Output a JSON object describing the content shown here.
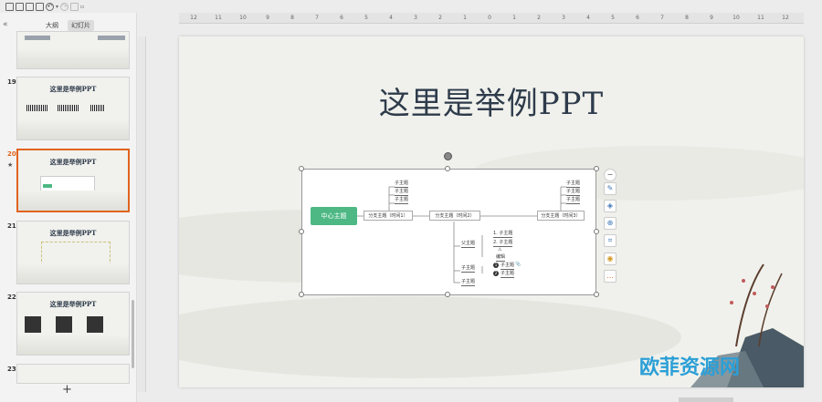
{
  "toolbar": {
    "icons": [
      "save-icon",
      "print-icon",
      "export-icon",
      "print-preview-icon",
      "undo-icon",
      "undo-dropdown-icon",
      "redo-icon",
      "format-painter-icon",
      "more-icon"
    ]
  },
  "sidebar": {
    "collapse_symbol": "«",
    "tabs": [
      {
        "label": "大纲",
        "active": false
      },
      {
        "label": "幻灯片",
        "active": true
      }
    ],
    "slides": [
      {
        "number": "",
        "title": ""
      },
      {
        "number": "19",
        "title": "这里是举例PPT"
      },
      {
        "number": "20",
        "title": "这里是举例PPT",
        "active": true,
        "star": "★"
      },
      {
        "number": "21",
        "title": "这里是举例PPT"
      },
      {
        "number": "22",
        "title": "这里是举例PPT"
      },
      {
        "number": "23",
        "title": ""
      }
    ],
    "add_symbol": "+"
  },
  "ruler": {
    "labels": [
      "12",
      "11",
      "10",
      "9",
      "8",
      "7",
      "6",
      "5",
      "4",
      "3",
      "2",
      "1",
      "0",
      "1",
      "2",
      "3",
      "4",
      "5",
      "6",
      "7",
      "8",
      "9",
      "10",
      "11",
      "12"
    ]
  },
  "slide": {
    "title": "这里是举例PPT",
    "mindmap": {
      "center": "中心主题",
      "branch1": "分支主题（时间1）",
      "branch2": "分支主题（时间2）",
      "branch3": "分支主题（时间3）",
      "leaf": "子主题",
      "parent": "父主题",
      "child1": "1. 子主题",
      "child2": "2. 子主题",
      "edit": "编辑",
      "num1": "1",
      "num2": "2"
    }
  },
  "float_tools": [
    "minus-icon",
    "edit-icon",
    "layers-icon",
    "zoom-icon",
    "crop-icon",
    "bulb-icon",
    "more-icon"
  ],
  "watermark": "欧菲资源网",
  "colors": {
    "accent": "#e0641e",
    "mindmap_center": "#4db884",
    "title": "#2e3b4b"
  }
}
